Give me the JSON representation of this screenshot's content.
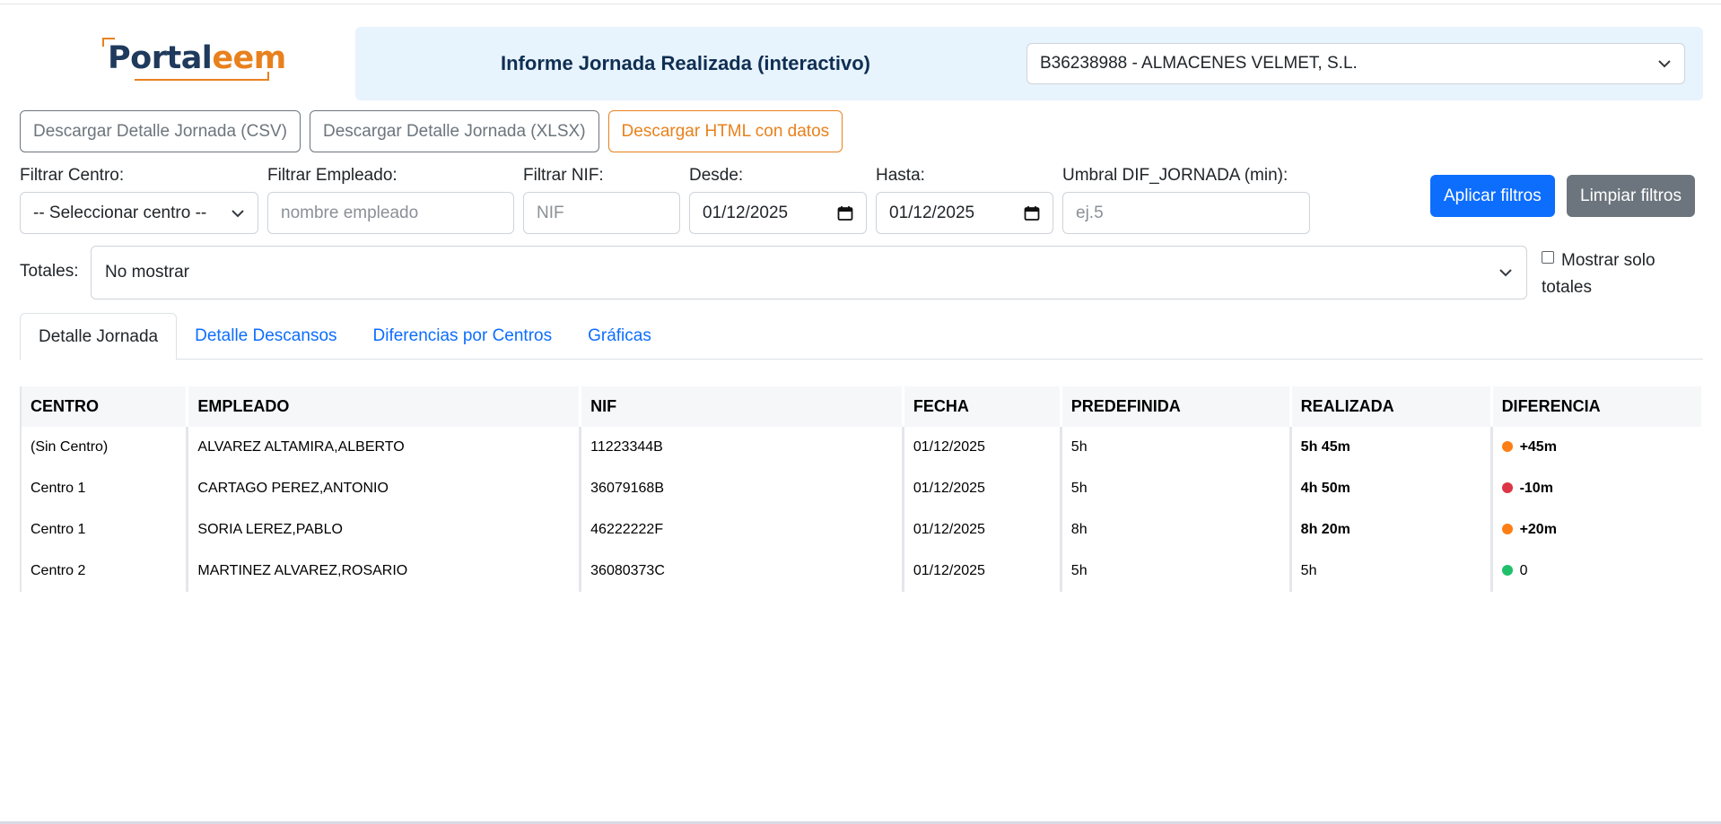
{
  "logo": {
    "part1": "Portal",
    "part2": "eem"
  },
  "header": {
    "title": "Informe Jornada Realizada (interactivo)",
    "company": "B36238988 - ALMACENES VELMET, S.L."
  },
  "downloads": {
    "csv": "Descargar Detalle Jornada (CSV)",
    "xlsx": "Descargar Detalle Jornada (XLSX)",
    "html": "Descargar HTML con datos"
  },
  "filters": {
    "centro_label": "Filtrar Centro:",
    "centro_value": "-- Seleccionar centro --",
    "empleado_label": "Filtrar Empleado:",
    "empleado_placeholder": "nombre empleado",
    "nif_label": "Filtrar NIF:",
    "nif_placeholder": "NIF",
    "desde_label": "Desde:",
    "desde_value": "01/12/2025",
    "hasta_label": "Hasta:",
    "hasta_value": "01/12/2025",
    "umbral_label": "Umbral DIF_JORNADA (min):",
    "umbral_placeholder": "ej.5",
    "apply": "Aplicar filtros",
    "clear": "Limpiar filtros"
  },
  "totals": {
    "label": "Totales:",
    "value": "No mostrar",
    "only_totals": "Mostrar solo totales",
    "only_totals_checked": false
  },
  "tabs": [
    {
      "label": "Detalle Jornada",
      "active": true
    },
    {
      "label": "Detalle Descansos",
      "active": false
    },
    {
      "label": "Diferencias por Centros",
      "active": false
    },
    {
      "label": "Gráficas",
      "active": false
    }
  ],
  "table": {
    "columns": [
      "CENTRO",
      "EMPLEADO",
      "NIF",
      "FECHA",
      "PREDEFINIDA",
      "REALIZADA",
      "DIFERENCIA"
    ],
    "rows": [
      {
        "centro": "(Sin Centro)",
        "empleado": "ALVAREZ ALTAMIRA,ALBERTO",
        "nif": "11223344B",
        "fecha": "01/12/2025",
        "predefinida": "5h",
        "realizada": "5h 45m",
        "realizada_bold": true,
        "diferencia": "+45m",
        "diferencia_bold": true,
        "status_color": "#fd7e14"
      },
      {
        "centro": "Centro 1",
        "empleado": "CARTAGO PEREZ,ANTONIO",
        "nif": "36079168B",
        "fecha": "01/12/2025",
        "predefinida": "5h",
        "realizada": "4h 50m",
        "realizada_bold": true,
        "diferencia": "-10m",
        "diferencia_bold": true,
        "status_color": "#dc3545"
      },
      {
        "centro": "Centro 1",
        "empleado": "SORIA LEREZ,PABLO",
        "nif": "46222222F",
        "fecha": "01/12/2025",
        "predefinida": "8h",
        "realizada": "8h 20m",
        "realizada_bold": true,
        "diferencia": "+20m",
        "diferencia_bold": true,
        "status_color": "#fd7e14"
      },
      {
        "centro": "Centro 2",
        "empleado": "MARTINEZ ALVAREZ,ROSARIO",
        "nif": "36080373C",
        "fecha": "01/12/2025",
        "predefinida": "5h",
        "realizada": "5h",
        "realizada_bold": false,
        "diferencia": "0",
        "diferencia_bold": false,
        "status_color": "#20c06a"
      }
    ]
  },
  "icons": {
    "dropdown": "chevron-down-icon",
    "calendar": "calendar-icon",
    "status": "status-dot-icon"
  }
}
